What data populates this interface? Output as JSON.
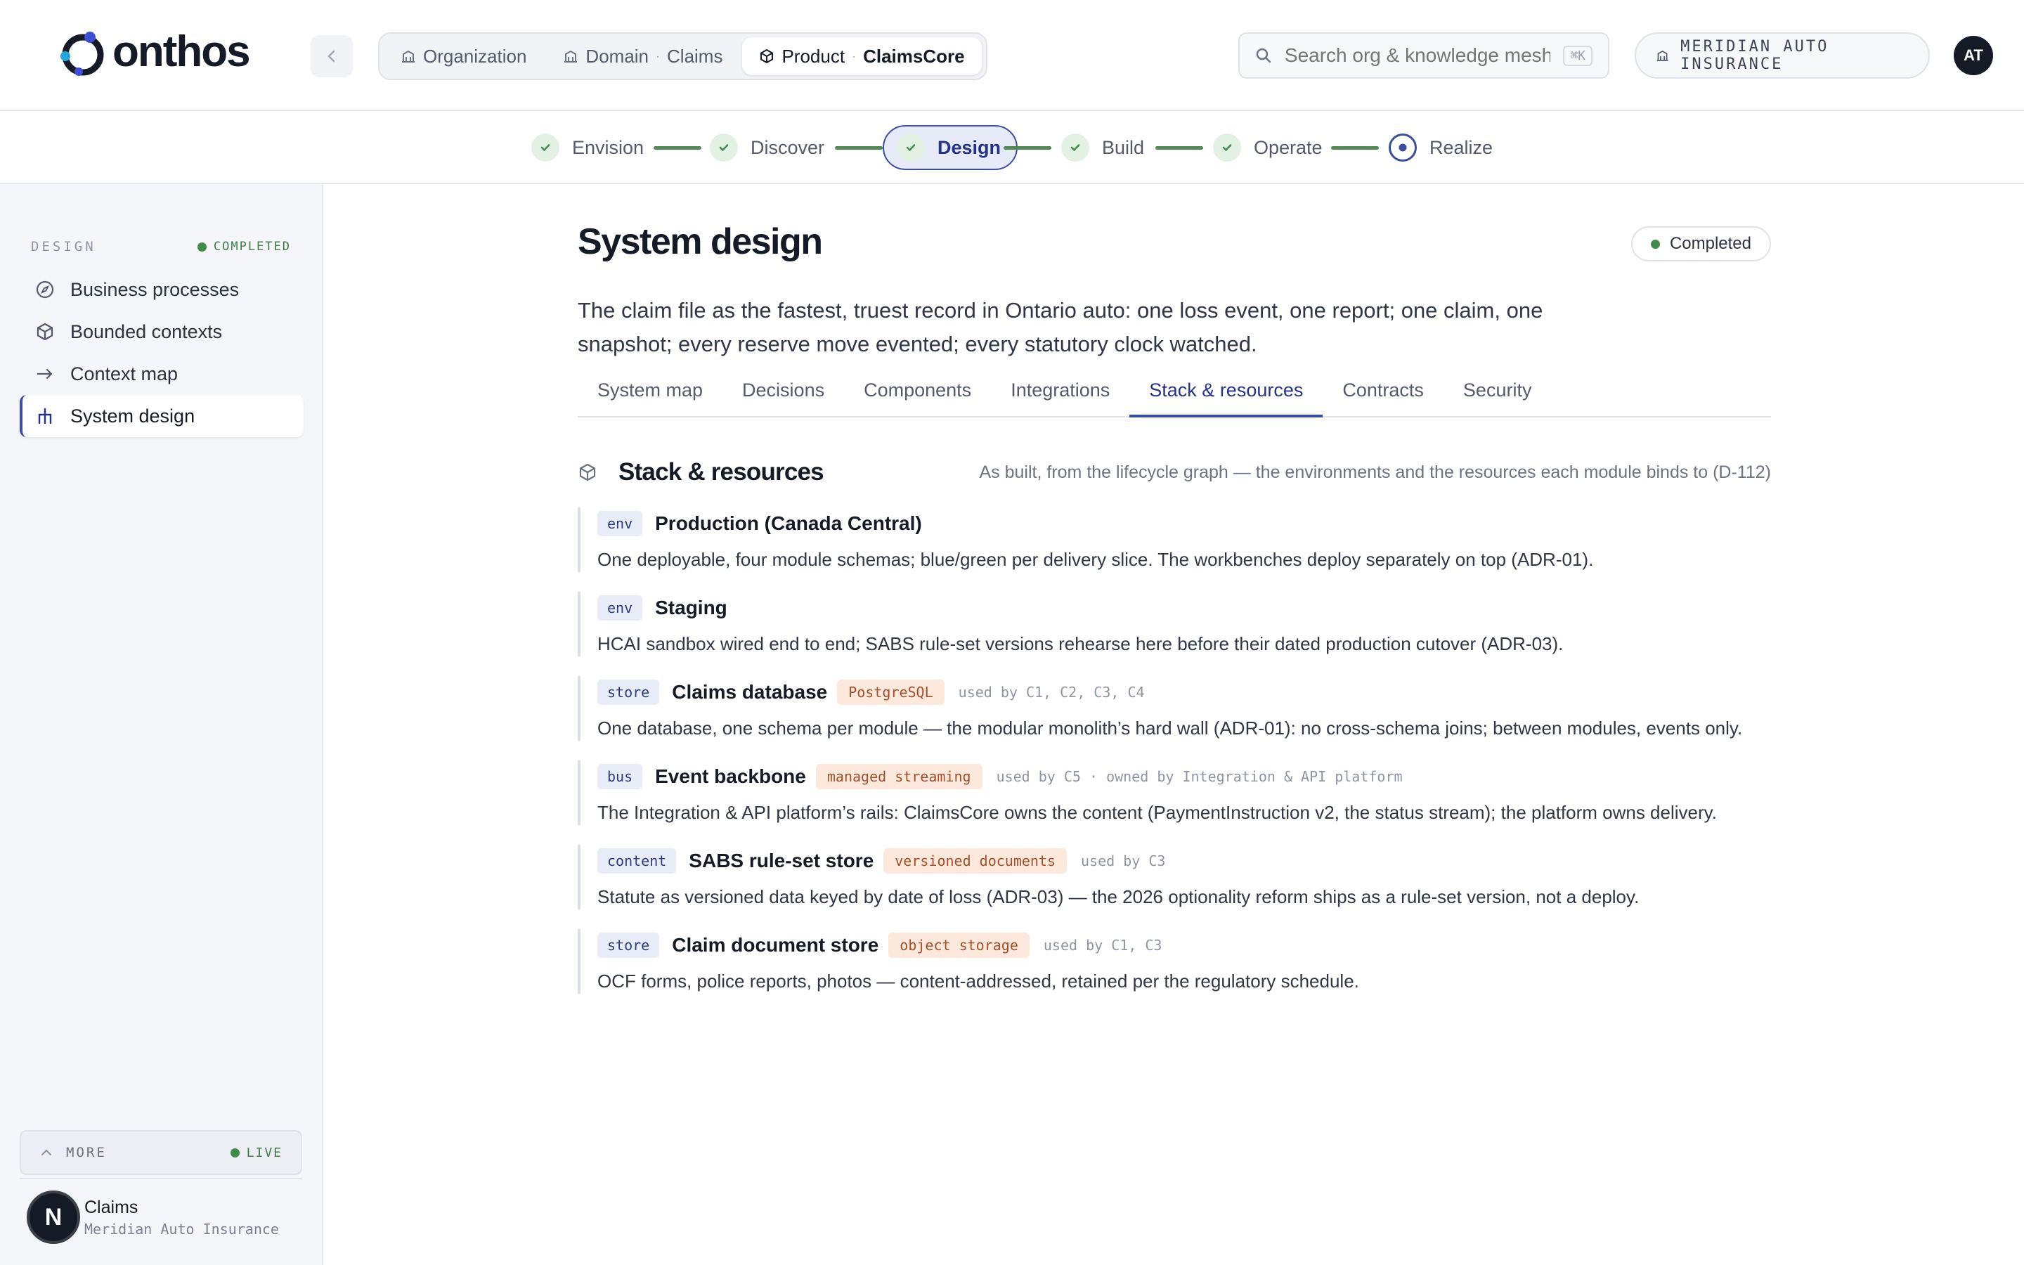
{
  "brand": {
    "name": "onthos"
  },
  "breadcrumbs": [
    {
      "label": "Organization",
      "value": ""
    },
    {
      "label": "Domain",
      "value": "Claims"
    },
    {
      "label": "Product",
      "value": "ClaimsCore"
    }
  ],
  "search": {
    "placeholder": "Search org & knowledge mesh",
    "shortcut": "⌘K"
  },
  "org": {
    "name": "MERIDIAN AUTO INSURANCE"
  },
  "user": {
    "initials": "AT"
  },
  "lifecycle": {
    "steps": [
      {
        "label": "Envision",
        "state": "done"
      },
      {
        "label": "Discover",
        "state": "done"
      },
      {
        "label": "Design",
        "state": "active"
      },
      {
        "label": "Build",
        "state": "done"
      },
      {
        "label": "Operate",
        "state": "done"
      },
      {
        "label": "Realize",
        "state": "current"
      }
    ]
  },
  "sidebar": {
    "section_title": "DESIGN",
    "status": "COMPLETED",
    "items": [
      {
        "label": "Business processes",
        "icon": "compass-icon"
      },
      {
        "label": "Bounded contexts",
        "icon": "cube-icon"
      },
      {
        "label": "Context map",
        "icon": "arrow-right-icon"
      },
      {
        "label": "System design",
        "icon": "hierarchy-icon",
        "active": true
      }
    ],
    "more_label": "MORE",
    "live_label": "LIVE",
    "workspace": {
      "initial": "N",
      "name": "Claims",
      "org": "Meridian Auto Insurance"
    }
  },
  "page": {
    "title": "System design",
    "status": "Completed",
    "lede": "The claim file as the fastest, truest record in Ontario auto: one loss event, one report; one claim, one snapshot; every reserve move evented; every statutory clock watched.",
    "tabs": [
      {
        "label": "System map"
      },
      {
        "label": "Decisions"
      },
      {
        "label": "Components"
      },
      {
        "label": "Integrations"
      },
      {
        "label": "Stack & resources",
        "active": true
      },
      {
        "label": "Contracts"
      },
      {
        "label": "Security"
      }
    ]
  },
  "section": {
    "title": "Stack & resources",
    "subtitle": "As built, from the lifecycle graph — the environments and the resources each module binds to (D-112)",
    "resources": [
      {
        "kind": "env",
        "name": "Production (Canada Central)",
        "tech": "",
        "used_by": "",
        "desc": "One deployable, four module schemas; blue/green per delivery slice. The workbenches deploy separately on top (ADR-01)."
      },
      {
        "kind": "env",
        "name": "Staging",
        "tech": "",
        "used_by": "",
        "desc": "HCAI sandbox wired end to end; SABS rule-set versions rehearse here before their dated production cutover (ADR-03)."
      },
      {
        "kind": "store",
        "name": "Claims database",
        "tech": "PostgreSQL",
        "used_by": "used by C1, C2, C3, C4",
        "desc": "One database, one schema per module — the modular monolith’s hard wall (ADR-01): no cross-schema joins; between modules, events only."
      },
      {
        "kind": "bus",
        "name": "Event backbone",
        "tech": "managed streaming",
        "used_by": "used by C5 · owned by Integration & API platform",
        "desc": "The Integration & API platform’s rails: ClaimsCore owns the content (PaymentInstruction v2, the status stream); the platform owns delivery."
      },
      {
        "kind": "content",
        "name": "SABS rule-set store",
        "tech": "versioned documents",
        "used_by": "used by C3",
        "desc": "Statute as versioned data keyed by date of loss (ADR-03) — the 2026 optionality reform ships as a rule-set version, not a deploy."
      },
      {
        "kind": "store",
        "name": "Claim document store",
        "tech": "object storage",
        "used_by": "used by C1, C3",
        "desc": "OCF forms, police reports, photos — content-addressed, retained per the regulatory schedule."
      }
    ]
  },
  "colors": {
    "accent": "#3c4ea0",
    "success": "#3f8c4a",
    "tech_bg": "#fde8dc",
    "kind_bg": "#e8ecf6"
  }
}
